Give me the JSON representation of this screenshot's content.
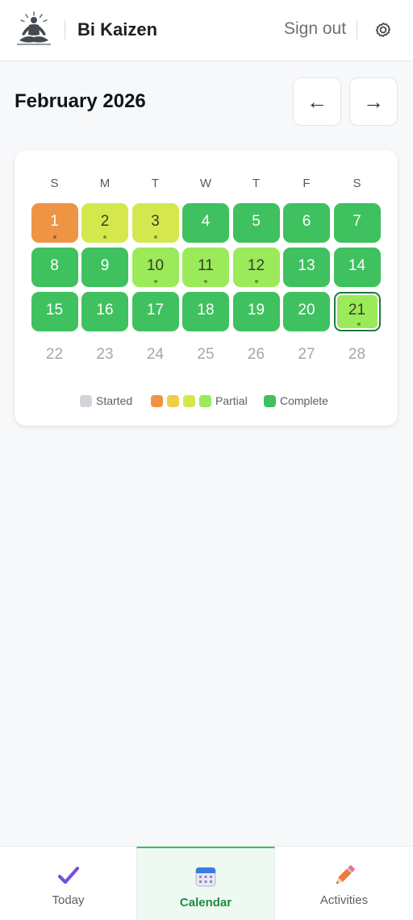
{
  "header": {
    "app_title": "Bi Kaizen",
    "sign_out_label": "Sign out",
    "logo_icon": "meditation-figure-icon",
    "settings_icon": "gear-icon"
  },
  "calendar": {
    "month_title": "February 2026",
    "prev_label": "←",
    "next_label": "→",
    "weekdays": [
      "S",
      "M",
      "T",
      "W",
      "T",
      "F",
      "S"
    ],
    "days": [
      {
        "n": "1",
        "status": "partial",
        "color": "#ef9445",
        "dot": true
      },
      {
        "n": "2",
        "status": "partial",
        "color": "#d4e84e",
        "dot": true
      },
      {
        "n": "3",
        "status": "partial",
        "color": "#d4e84e",
        "dot": true
      },
      {
        "n": "4",
        "status": "complete",
        "color": "#3fc15f",
        "dot": false
      },
      {
        "n": "5",
        "status": "complete",
        "color": "#3fc15f",
        "dot": false
      },
      {
        "n": "6",
        "status": "complete",
        "color": "#3fc15f",
        "dot": false
      },
      {
        "n": "7",
        "status": "complete",
        "color": "#3fc15f",
        "dot": false
      },
      {
        "n": "8",
        "status": "complete",
        "color": "#3fc15f",
        "dot": false
      },
      {
        "n": "9",
        "status": "complete",
        "color": "#3fc15f",
        "dot": false
      },
      {
        "n": "10",
        "status": "partial",
        "color": "#9aea5a",
        "dot": true
      },
      {
        "n": "11",
        "status": "partial",
        "color": "#9aea5a",
        "dot": true
      },
      {
        "n": "12",
        "status": "partial",
        "color": "#9aea5a",
        "dot": true
      },
      {
        "n": "13",
        "status": "complete",
        "color": "#3fc15f",
        "dot": false
      },
      {
        "n": "14",
        "status": "complete",
        "color": "#3fc15f",
        "dot": false
      },
      {
        "n": "15",
        "status": "complete",
        "color": "#3fc15f",
        "dot": false
      },
      {
        "n": "16",
        "status": "complete",
        "color": "#3fc15f",
        "dot": false
      },
      {
        "n": "17",
        "status": "complete",
        "color": "#3fc15f",
        "dot": false
      },
      {
        "n": "18",
        "status": "complete",
        "color": "#3fc15f",
        "dot": false
      },
      {
        "n": "19",
        "status": "complete",
        "color": "#3fc15f",
        "dot": false
      },
      {
        "n": "20",
        "status": "complete",
        "color": "#3fc15f",
        "dot": false
      },
      {
        "n": "21",
        "status": "partial",
        "color": "#9aea5a",
        "dot": true,
        "today": true
      },
      {
        "n": "22",
        "status": "none",
        "color": "",
        "dot": false
      },
      {
        "n": "23",
        "status": "none",
        "color": "",
        "dot": false
      },
      {
        "n": "24",
        "status": "none",
        "color": "",
        "dot": false
      },
      {
        "n": "25",
        "status": "none",
        "color": "",
        "dot": false
      },
      {
        "n": "26",
        "status": "none",
        "color": "",
        "dot": false
      },
      {
        "n": "27",
        "status": "none",
        "color": "",
        "dot": false
      },
      {
        "n": "28",
        "status": "none",
        "color": "",
        "dot": false
      }
    ],
    "legend": {
      "started_label": "Started",
      "started_color": "#d1d5da",
      "partial_label": "Partial",
      "partial_colors": [
        "#ef9445",
        "#f0cf48",
        "#d4e84e",
        "#9aea5a"
      ],
      "complete_label": "Complete",
      "complete_color": "#3fc15f"
    }
  },
  "bottom_nav": {
    "tabs": [
      {
        "label": "Today",
        "icon": "checkmark-icon",
        "active": false
      },
      {
        "label": "Calendar",
        "icon": "calendar-icon",
        "active": true
      },
      {
        "label": "Activities",
        "icon": "pencil-icon",
        "active": false
      }
    ]
  }
}
